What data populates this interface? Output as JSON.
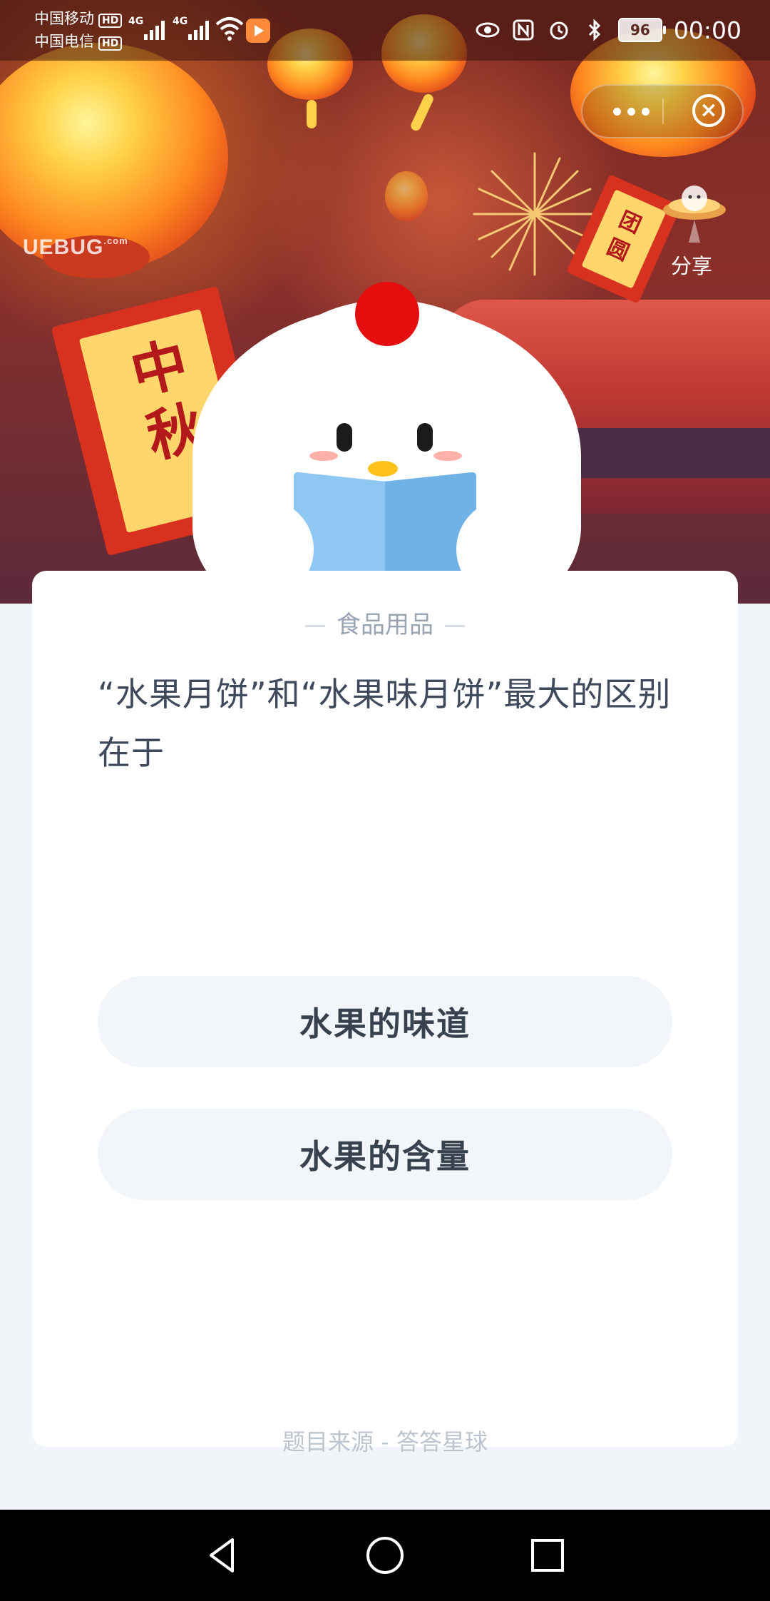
{
  "status_bar": {
    "carrier_1": "中国移动",
    "carrier_2": "中国电信",
    "hd_badge": "HD",
    "network_1": "4G",
    "network_2": "4G",
    "battery": "96",
    "time": "00:00"
  },
  "banner": {
    "scroll_text": "中秋",
    "small_scroll_text": "团圆",
    "watermark": "UEBUG",
    "watermark_sub": ".com",
    "share_label": "分享"
  },
  "card": {
    "category": "食品用品",
    "question": "“水果月饼”和“水果味月饼”最大的区别在于",
    "options": [
      {
        "label": "水果的味道"
      },
      {
        "label": "水果的含量"
      }
    ],
    "source": "题目来源 - 答答星球"
  },
  "colors": {
    "accent_red": "#e50d0d",
    "card_bg": "#ffffff",
    "option_bg": "#f2f5f9",
    "text_primary": "#3e4a5c"
  },
  "icons": [
    "eye-comfort-icon",
    "nfc-icon",
    "alarm-icon",
    "bluetooth-icon",
    "wifi-icon",
    "signal-icon",
    "more-icon",
    "close-icon",
    "share-icon",
    "back-icon",
    "home-icon",
    "recents-icon"
  ]
}
